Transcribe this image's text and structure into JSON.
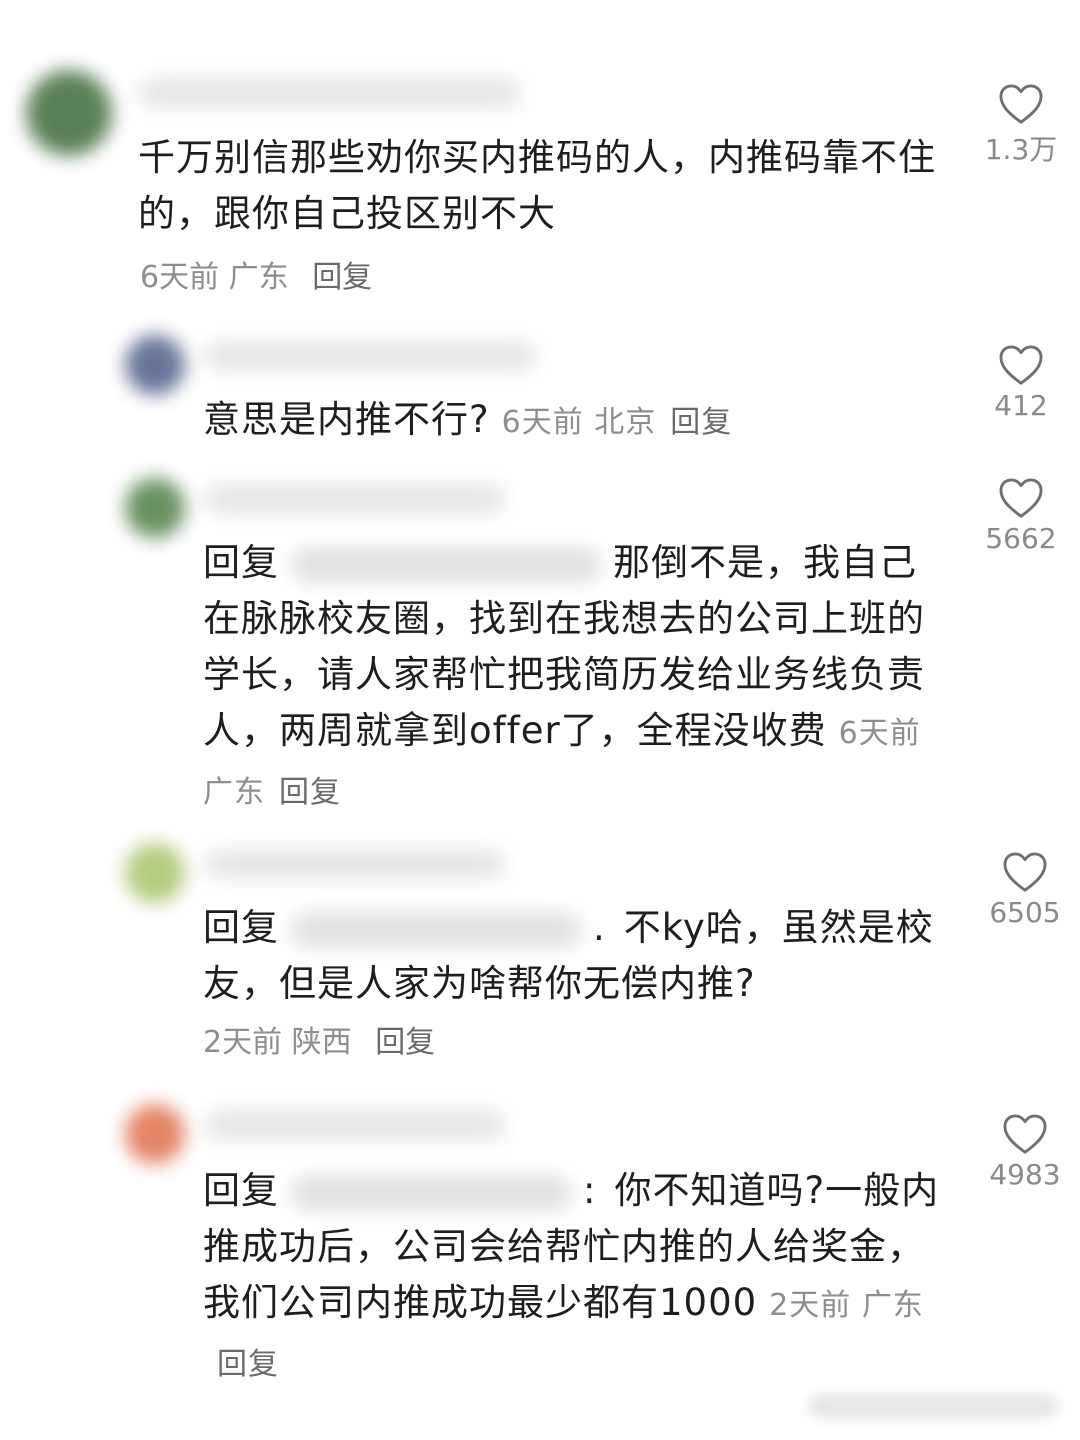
{
  "comments": [
    {
      "text": "千万别信那些劝你买内推码的人，内推码靠不住的，跟你自己投区别不大",
      "time": "6天前",
      "location": "广东",
      "reply_label": "回复",
      "likes": "1.3万",
      "avatar_color": "#3f6b3a"
    },
    {
      "text": "意思是内推不行?",
      "time": "6天前",
      "location": "北京",
      "reply_label": "回复",
      "likes": "412",
      "avatar_color": "#4d5e88"
    },
    {
      "prefix": "回复",
      "text": "那倒不是，我自己在脉脉校友圈，找到在我想去的公司上班的学长，请人家帮忙把我简历发给业务线负责人，两周就拿到offer了，全程没收费",
      "time": "6天前",
      "location": "广东",
      "reply_label": "回复",
      "likes": "5662",
      "avatar_color": "#4f7f45"
    },
    {
      "prefix": "回复",
      "separator": ".",
      "text": "不ky哈，虽然是校友，但是人家为啥帮你无偿内推?",
      "time": "2天前",
      "location": "陕西",
      "reply_label": "回复",
      "likes": "6505",
      "avatar_color": "#a6c46a"
    },
    {
      "prefix": "回复",
      "separator": ":",
      "text": "你不知道吗?一般内推成功后，公司会给帮忙内推的人给奖金，我们公司内推成功最少都有1000",
      "time": "2天前",
      "location": "广东",
      "reply_label": "回复",
      "likes": "4983",
      "avatar_color": "#e0704c"
    }
  ]
}
